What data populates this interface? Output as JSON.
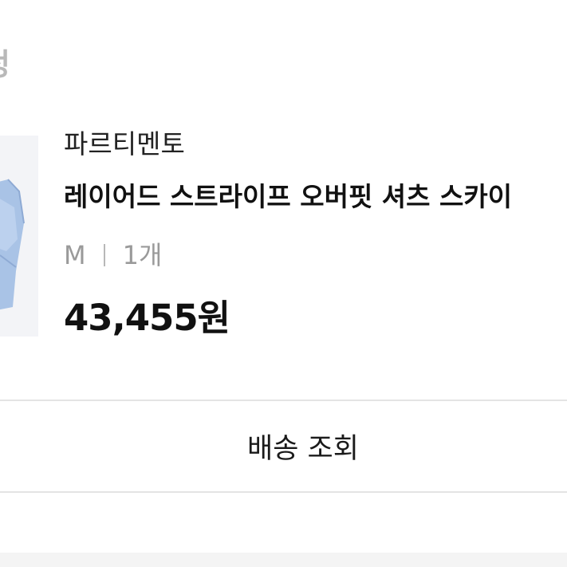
{
  "order": {
    "status_heading": "정",
    "brand": "파르티멘토",
    "product_name": "레이어드 스트라이프 오버핏 셔츠 스카이",
    "option_size": "M",
    "option_quantity": "1개",
    "price": "43,455원",
    "thumbnail_icon": "shirt-thumbnail-icon"
  },
  "actions": {
    "delivery_tracking_label": "배송 조회"
  },
  "colors": {
    "shirt": "#a9c3e6",
    "muted_text": "#9a9a9a",
    "border": "#e4e4e4"
  }
}
